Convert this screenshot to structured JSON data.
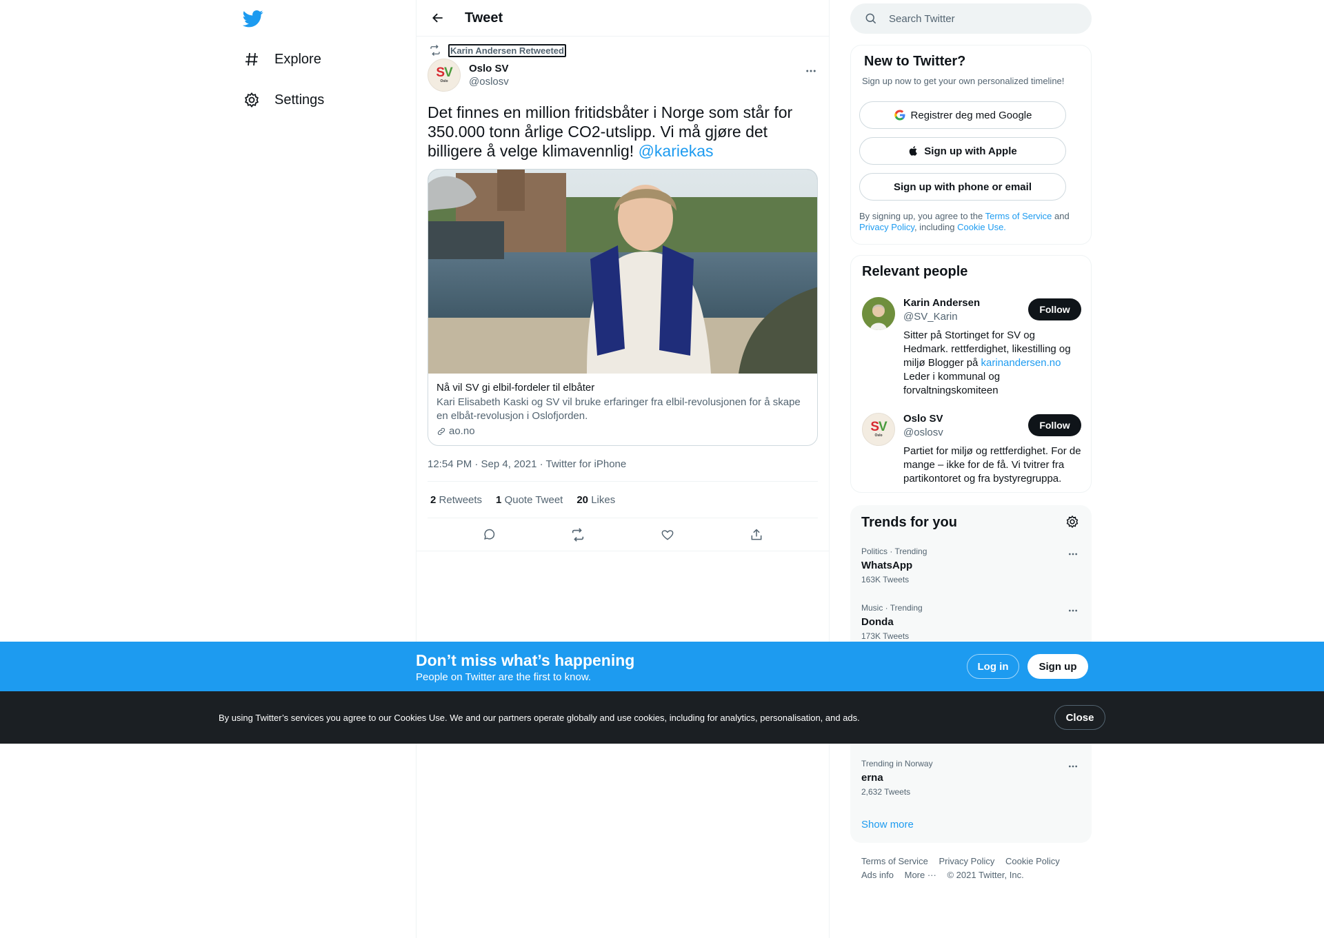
{
  "nav": {
    "items": [
      {
        "label": "Explore",
        "icon": "hashtag-icon"
      },
      {
        "label": "Settings",
        "icon": "gear-icon"
      }
    ]
  },
  "header": {
    "title": "Tweet"
  },
  "tweet": {
    "retweeted_by": "Karin Andersen Retweeted",
    "author_name": "Oslo SV",
    "author_handle": "@oslosv",
    "avatar_text": "SV",
    "avatar_sub": "Oslo",
    "text": "Det finnes en million fritidsbåter i Norge som står for 350.000 tonn årlige CO2-utslipp. Vi må gjøre det billigere å velge klimavennlig!",
    "mention": "@kariekas",
    "card": {
      "title": "Nå vil SV gi elbil-fordeler til elbåter",
      "description": "Kari Elisabeth Kaski og SV vil bruke erfaringer fra elbil-revolusjonen for å skape en elbåt-revolusjon i Oslofjorden.",
      "domain": "ao.no"
    },
    "meta": "12:54 PM · Sep 4, 2021 · Twitter for iPhone",
    "stats": {
      "retweets_count": "2",
      "retweets_label": "Retweets",
      "quotes_count": "1",
      "quotes_label": "Quote Tweet",
      "likes_count": "20",
      "likes_label": "Likes"
    }
  },
  "search": {
    "placeholder": "Search Twitter"
  },
  "signup": {
    "title": "New to Twitter?",
    "subtitle": "Sign up now to get your own personalized timeline!",
    "google_label": "Registrer deg med Google",
    "apple_label": "Sign up with Apple",
    "phone_label": "Sign up with phone or email",
    "legal_1": "By signing up, you agree to the ",
    "terms": "Terms of Service",
    "legal_2": " and ",
    "privacy": "Privacy Policy",
    "legal_3": ", including ",
    "cookie": "Cookie Use."
  },
  "people": {
    "title": "Relevant people",
    "list": [
      {
        "name": "Karin Andersen",
        "handle": "@SV_Karin",
        "bio_1": "Sitter på Stortinget for SV og Hedmark. rettferdighet, likestilling og miljø Blogger på ",
        "bio_link": "karinandersen.no",
        "bio_2": " Leder i kommunal og forvaltningskomiteen",
        "follow": "Follow"
      },
      {
        "name": "Oslo SV",
        "handle": "@oslosv",
        "bio_1": "Partiet for miljø og rettferdighet. For de mange – ikke for de få. Vi tvitrer fra partikontoret og fra bystyregruppa.",
        "follow": "Follow"
      }
    ]
  },
  "trends": {
    "title": "Trends for you",
    "items": [
      {
        "context": "Politics · Trending",
        "name": "WhatsApp",
        "count": "163K Tweets"
      },
      {
        "context": "Music · Trending",
        "name": "Donda",
        "count": "173K Tweets"
      },
      {
        "context": "Trending in Norway",
        "name": "erna",
        "count": "2,632 Tweets"
      }
    ],
    "show_more": "Show more"
  },
  "footer": {
    "terms": "Terms of Service",
    "privacy": "Privacy Policy",
    "cookie": "Cookie Policy",
    "ads": "Ads info",
    "more": "More ···",
    "copyright": "© 2021 Twitter, Inc."
  },
  "bottom_bar": {
    "title": "Don’t miss what’s happening",
    "subtitle": "People on Twitter are the first to know.",
    "login": "Log in",
    "signup": "Sign up"
  },
  "cookie_bar": {
    "text": "By using Twitter’s services you agree to our Cookies Use. We and our partners operate globally and use cookies, including for analytics, personalisation, and ads.",
    "close": "Close"
  },
  "colors": {
    "accent": "#1d9bf0",
    "dark": "#0f1419",
    "muted": "#536471"
  }
}
